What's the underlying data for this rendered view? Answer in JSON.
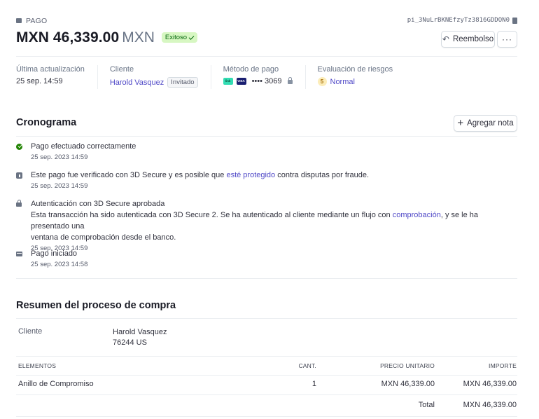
{
  "header": {
    "kicker": "PAGO",
    "payment_id": "pi_3NuLrBKNEfzyTz3816GDDON0",
    "amount": "MXN 46,339.00",
    "currency": "MXN",
    "status": "Exitoso",
    "refund_label": "Reembolso",
    "more_label": "···"
  },
  "summary": {
    "updated_label": "Última actualización",
    "updated_value": "25 sep. 14:59",
    "customer_label": "Cliente",
    "customer_value": "Harold Vasquez",
    "customer_badge": "Invitado",
    "method_label": "Método de pago",
    "card_brand_1": "link",
    "card_brand_2": "VISA",
    "card_last4": "•••• 3069",
    "risk_label": "Evaluación de riesgos",
    "risk_score": "5",
    "risk_value": "Normal"
  },
  "timeline": {
    "title": "Cronograma",
    "add_note": "Agregar nota",
    "events": [
      {
        "icon": "check-circle-icon",
        "title": "Pago efectuado correctamente",
        "date": "25 sep. 2023 14:59"
      },
      {
        "icon": "info-icon",
        "pre": "Este pago fue verificado con 3D Secure y es posible que ",
        "link": "esté protegido",
        "post": " contra disputas por fraude.",
        "date": "25 sep. 2023 14:59"
      },
      {
        "icon": "lock-icon",
        "title": "Autenticación con 3D Secure aprobada",
        "desc_pre": "Esta transacción ha sido autenticada con 3D Secure 2. Se ha autenticado al cliente mediante un flujo con ",
        "desc_link": "comprobación",
        "desc_post": ", y se le ha presentado una",
        "desc_line2": "ventana de comprobación desde el banco.",
        "date": "25 sep. 2023 14:59"
      },
      {
        "icon": "card-icon",
        "title": "Pago iniciado",
        "date": "25 sep. 2023 14:58"
      }
    ]
  },
  "checkout": {
    "title": "Resumen del proceso de compra",
    "customer_label": "Cliente",
    "customer_name": "Harold Vasquez",
    "customer_address": "76244 US",
    "columns": [
      "ELEMENTOS",
      "CANT.",
      "PRECIO UNITARIO",
      "IMPORTE"
    ],
    "items": [
      {
        "name": "Anillo de Compromiso",
        "qty": "1",
        "unit_price": "MXN 46,339.00",
        "amount": "MXN 46,339.00"
      }
    ],
    "total_label": "Total",
    "total_value": "MXN 46,339.00"
  },
  "colors": {
    "accent": "#4f48c7",
    "success_bg": "#d7f7c2",
    "success_text": "#05690d"
  }
}
